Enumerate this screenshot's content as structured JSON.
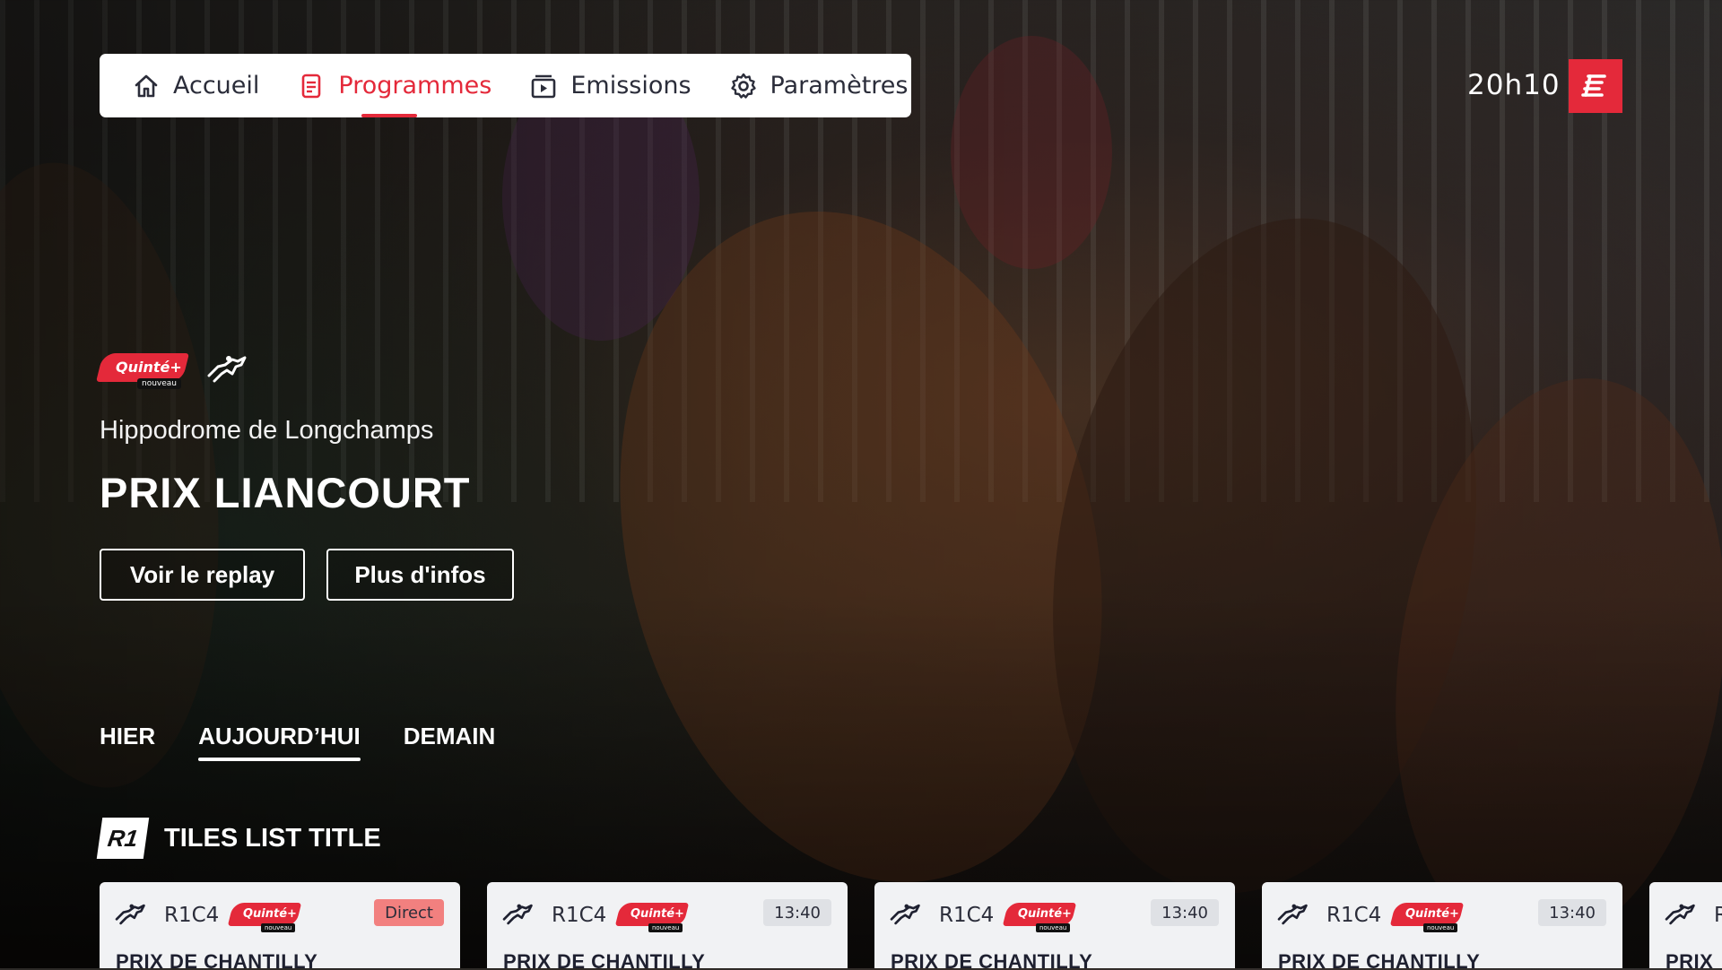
{
  "nav": {
    "items": [
      {
        "label": "Accueil",
        "icon": "home-icon",
        "active": false
      },
      {
        "label": "Programmes",
        "icon": "document-icon",
        "active": true
      },
      {
        "label": "Emissions",
        "icon": "tv-icon",
        "active": false
      },
      {
        "label": "Paramètres",
        "icon": "gear-icon",
        "active": false
      }
    ],
    "active_color": "#e4293a"
  },
  "header": {
    "time": "20h10",
    "logo_icon": "equidia-logo-icon"
  },
  "hero": {
    "badge": {
      "label": "Quinté+",
      "sub": "nouveau"
    },
    "discipline_icon": "galloping-horse-icon",
    "venue": "Hippodrome de Longchamps",
    "title": "PRIX LIANCOURT",
    "buttons": {
      "replay": "Voir le replay",
      "infos": "Plus d'infos"
    }
  },
  "day_tabs": [
    {
      "label": "HIER",
      "active": false
    },
    {
      "label": "AUJOURD’HUI",
      "active": true
    },
    {
      "label": "DEMAIN",
      "active": false
    }
  ],
  "tiles_list": {
    "reunion_badge": "R1",
    "title": "TILES LIST TITLE",
    "tiles": [
      {
        "code": "R1C4",
        "badge": "Quinté+",
        "badge_sub": "nouveau",
        "status": "Direct",
        "live": true,
        "name": "PRIX DE CHANTILLY"
      },
      {
        "code": "R1C4",
        "badge": "Quinté+",
        "badge_sub": "nouveau",
        "status": "13:40",
        "live": false,
        "name": "PRIX DE CHANTILLY"
      },
      {
        "code": "R1C4",
        "badge": "Quinté+",
        "badge_sub": "nouveau",
        "status": "13:40",
        "live": false,
        "name": "PRIX DE CHANTILLY"
      },
      {
        "code": "R1C4",
        "badge": "Quinté+",
        "badge_sub": "nouveau",
        "status": "13:40",
        "live": false,
        "name": "PRIX DE CHANTILLY"
      },
      {
        "code": "R",
        "badge": "",
        "badge_sub": "",
        "status": "",
        "live": false,
        "name": "PRIX"
      }
    ]
  }
}
